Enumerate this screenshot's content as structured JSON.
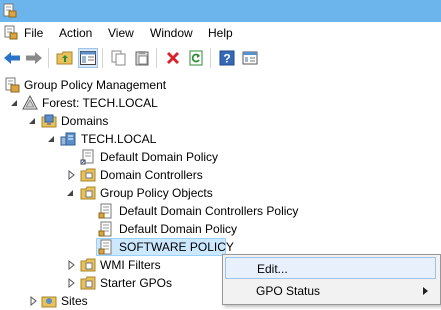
{
  "menu": [
    "File",
    "Action",
    "View",
    "Window",
    "Help"
  ],
  "toolbar": {
    "icons": [
      "back-arrow-icon",
      "forward-arrow-icon",
      "up-folder-icon",
      "show-hide-console-tree-icon",
      "copy-icon",
      "paste-icon",
      "delete-icon",
      "refresh-icon",
      "help-icon",
      "properties-icon"
    ]
  },
  "tree": {
    "root": "Group Policy Management",
    "forest": "Forest: TECH.LOCAL",
    "domains": "Domains",
    "domain": "TECH.LOCAL",
    "default_domain_policy": "Default Domain Policy",
    "domain_controllers": "Domain Controllers",
    "gpo_folder": "Group Policy Objects",
    "gpos": [
      "Default Domain Controllers Policy",
      "Default Domain Policy",
      "SOFTWARE POLICY"
    ],
    "wmi_filters": "WMI Filters",
    "starter_gpos": "Starter GPOs",
    "sites": "Sites"
  },
  "context_menu": {
    "edit": "Edit...",
    "gpo_status": "GPO Status"
  },
  "colors": {
    "titlebar": "#6cb4ec",
    "selection": "#cce8ff",
    "menu_highlight": "#e8f1fb"
  }
}
